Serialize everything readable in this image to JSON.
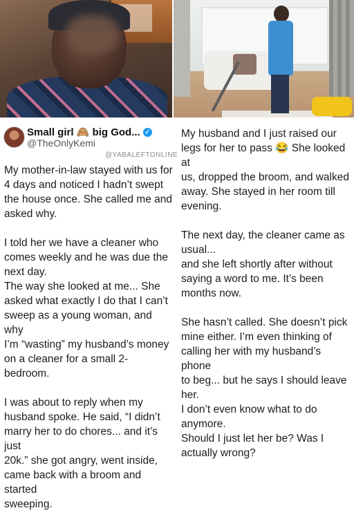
{
  "post": {
    "display_name": "Small girl 🙈 big God...",
    "handle": "@TheOnlyKemi",
    "verified": true,
    "watermark": "@YABALEFTONLINE"
  },
  "left_column": {
    "p1": "My mother-in-law stayed with us for\n4 days and noticed I hadn’t swept\nthe house once. She called me and\nasked why.",
    "p2": "I told her we have a cleaner who\ncomes weekly and he was due the\nnext day.\nThe way she looked at me... She\nasked what exactly I do that I can’t\nsweep as a young woman, and why\nI’m “wasting” my husband’s money\non a cleaner for a small 2-bedroom.",
    "p3": "I was about to reply when my\nhusband spoke. He said, “I didn’t\nmarry her to do chores... and it’s just\n20k.” she got angry, went inside,\ncame back with a broom and started\nsweeping."
  },
  "right_column": {
    "p1": "My husband and I just raised our\nlegs for her to pass 😂 She looked at\nus, dropped the broom, and walked\naway. She stayed in her room till\nevening.",
    "p2": "The next day, the cleaner came as\nusual...\nand she left shortly after without\nsaying a word to me. It’s been\nmonths now.",
    "p3": "She hasn’t called. She doesn’t pick\nmine either. I’m even thinking of\ncalling her with my husband’s phone\nto beg... but he says I should leave\nher.\nI don’t even know what to do\nanymore.\nShould I just let her be? Was I\nactually wrong?"
  },
  "colors": {
    "verified": "#1d9bf0",
    "text": "#1c1c1c",
    "watermark": "#8a8a8a"
  }
}
